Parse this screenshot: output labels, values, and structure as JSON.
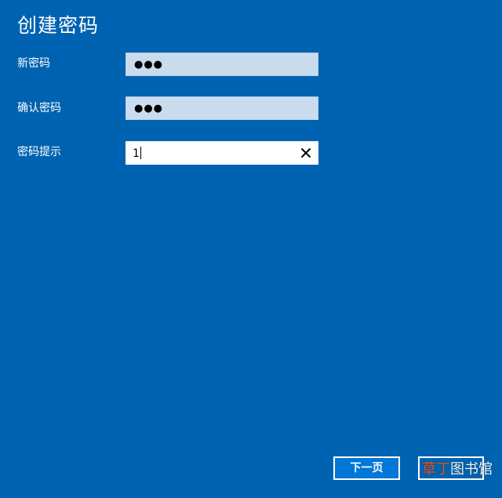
{
  "page": {
    "title": "创建密码"
  },
  "form": {
    "new_password": {
      "label": "新密码",
      "masked_value": "●●●"
    },
    "confirm_password": {
      "label": "确认密码",
      "masked_value": "●●●"
    },
    "password_hint": {
      "label": "密码提示",
      "value": "1"
    }
  },
  "buttons": {
    "next_label": "下一页"
  },
  "watermark": {
    "accent": "草丁",
    "rest": "图书馆"
  },
  "colors": {
    "background": "#0063b1",
    "button_primary": "#0078d7",
    "field_inactive": "#c9dced",
    "watermark_accent": "#e8541e"
  },
  "icons": {
    "clear": "close-icon"
  }
}
